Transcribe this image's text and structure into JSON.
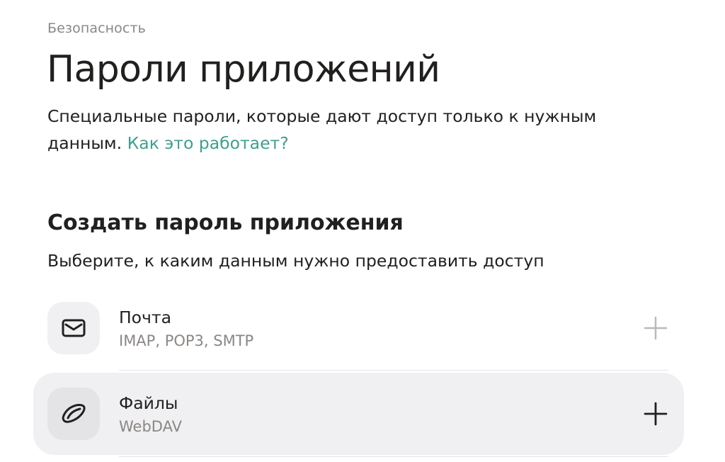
{
  "breadcrumb": "Безопасность",
  "page_title": "Пароли приложений",
  "description": {
    "text": "Специальные пароли, которые дают доступ только к нужным данным.",
    "link": "Как это работает?"
  },
  "create_section": {
    "title": "Создать пароль приложения",
    "subtitle": "Выберите, к каким данным нужно предоставить доступ",
    "items": [
      {
        "title": "Почта",
        "subtitle": "IMAP, POP3, SMTP",
        "icon": "envelope-icon",
        "action_icon": "plus-icon"
      },
      {
        "title": "Файлы",
        "subtitle": "WebDAV",
        "icon": "disk-icon",
        "action_icon": "plus-icon"
      }
    ]
  },
  "colors": {
    "link": "#3f9e8f",
    "muted_text": "#8a8784",
    "hover_background": "#f0f0f2"
  }
}
